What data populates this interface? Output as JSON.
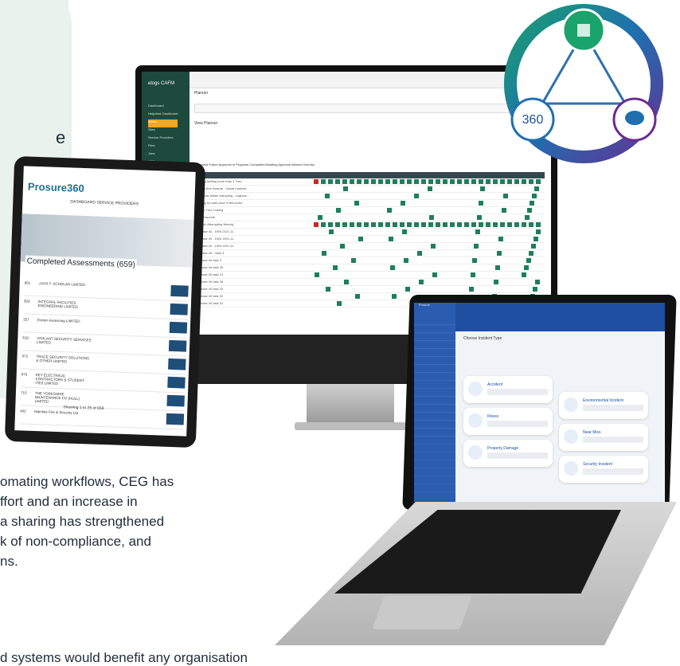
{
  "intro_fragment": "e",
  "body_text": {
    "lines": [
      "omating workflows, CEG has",
      "ffort and an increase in",
      "a sharing has strengthened",
      "k of non-compliance, and",
      "ns."
    ],
    "last_line": "d systems would benefit any organisation"
  },
  "monitor": {
    "app_name": "elogs CAFM",
    "page_title": "Planner",
    "view_title": "View Planner",
    "nav": [
      "Dashboard",
      "Helpdesk Dashboard",
      "Admin",
      "Sites",
      "Service Providers",
      "Files",
      "Jobs",
      "PDF"
    ],
    "legend": "Approved  Future Approval  In Progress  Completed  Awaiting Approval  Missed  Overdue",
    "rows": [
      "Testing Adding more than 1 Trav...",
      "Distribution Boards - Visual Inspecti...",
      "Domestic Water Sampling - Legione...",
      "Testing to mark save it still works",
      "Bush / Tree Cutting",
      "Tidy Grounds",
      "Air Con Attempting Weekly",
      "Release 40 - DSN 2021.11",
      "Release 40 - DSN 2021.11",
      "Release 40 - DSN 2021.11",
      "Release 40 - Task 3",
      "Release 40 task 3",
      "Release 40 task 30",
      "Release 40 task 31",
      "Release 40 task 28",
      "Release 40 task 29",
      "Release 40 task 32",
      "Release 40 task 31"
    ]
  },
  "tablet": {
    "logo": "Prosure360",
    "nav": "DASHBOARD  SERVICE PROVIDERS",
    "title": "Completed Assessments (659)",
    "rows": [
      {
        "id": "861",
        "name": "J.M.B.Y. SCHOLAR LIMITED"
      },
      {
        "id": "303",
        "name": "INTEGRAL FACILITIES ENGINEERING LIMITED"
      },
      {
        "id": "327",
        "name": "Exeter Assessing LIMITED"
      },
      {
        "id": "616",
        "name": "VIGILANT SECURITY SERVICES LIMITED"
      },
      {
        "id": "972",
        "name": "TRACE SECURITY SOLUTIONS & OTHER LIMITED"
      },
      {
        "id": "975",
        "name": "KEY ELECTRICAL CONTRACTORS & STUDENT ITES LIMITED"
      },
      {
        "id": "710",
        "name": "THE YORKSHIRE MAINTENANCE CO (HULL) LIMITED"
      },
      {
        "id": "402",
        "name": "Mainline Fire & Security Ltd"
      }
    ],
    "pager": "Showing 1 to 25 of 659"
  },
  "laptop": {
    "app_name": "Prosure",
    "title": "Choose Incident Type",
    "cards": [
      "Accident",
      "Environmental Incident",
      "Illness",
      "Near Miss",
      "Property Damage",
      "Security Incident"
    ]
  },
  "badge": {
    "label_360": "360"
  },
  "colors": {
    "panel_bg": "#eaf2ee",
    "cafm_green": "#1d4a3c",
    "planner_cell": "#1e7f5a",
    "laptop_blue": "#2a5db0"
  }
}
